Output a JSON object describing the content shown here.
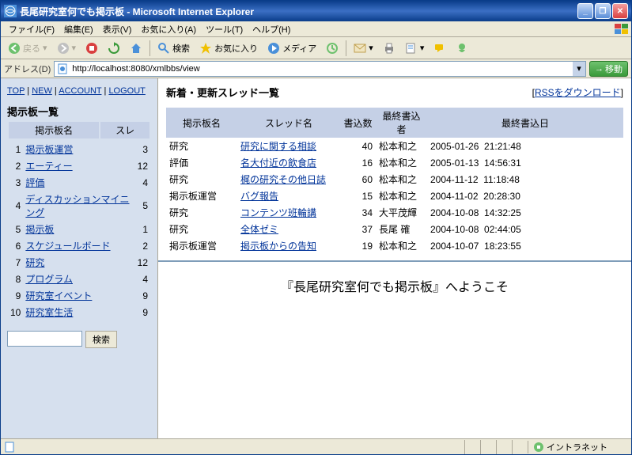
{
  "window": {
    "title": "長尾研究室何でも掲示板 - Microsoft Internet Explorer"
  },
  "menu": {
    "file": "ファイル(F)",
    "edit": "編集(E)",
    "view": "表示(V)",
    "favorites": "お気に入り(A)",
    "tools": "ツール(T)",
    "help": "ヘルプ(H)"
  },
  "toolbar": {
    "back": "戻る",
    "search": "検索",
    "favorites": "お気に入り",
    "media": "メディア"
  },
  "address": {
    "label": "アドレス(D)",
    "value": "http://localhost:8080/xmlbbs/view",
    "go": "移動"
  },
  "nav": {
    "top": "TOP",
    "new": "NEW",
    "account": "ACCOUNT",
    "logout": "LOGOUT"
  },
  "sidebar": {
    "heading": "掲示板一覧",
    "cols": {
      "name": "掲示板名",
      "count": "スレ"
    },
    "items": [
      {
        "n": "1",
        "name": "掲示板運営",
        "count": "3"
      },
      {
        "n": "2",
        "name": "エーティー",
        "count": "12"
      },
      {
        "n": "3",
        "name": "評価",
        "count": "4"
      },
      {
        "n": "4",
        "name": "ディスカッションマイニング",
        "count": "5"
      },
      {
        "n": "5",
        "name": "掲示板",
        "count": "1"
      },
      {
        "n": "6",
        "name": "スケジュールボード",
        "count": "2"
      },
      {
        "n": "7",
        "name": "研究",
        "count": "12"
      },
      {
        "n": "8",
        "name": "プログラム",
        "count": "4"
      },
      {
        "n": "9",
        "name": "研究室イベント",
        "count": "9"
      },
      {
        "n": "10",
        "name": "研究室生活",
        "count": "9"
      }
    ],
    "search_btn": "検索"
  },
  "main": {
    "heading": "新着・更新スレッド一覧",
    "rss": "RSSをダウンロード",
    "cols": {
      "board": "掲示板名",
      "thread": "スレッド名",
      "posts": "書込数",
      "lastposter": "最終書込者",
      "lastdate": "最終書込日"
    },
    "rows": [
      {
        "board": "研究",
        "thread": "研究に関する相談",
        "posts": "40",
        "poster": "松本和之",
        "date": "2005-01-26",
        "time": "21:21:48"
      },
      {
        "board": "評価",
        "thread": "名大付近の飲食店",
        "posts": "16",
        "poster": "松本和之",
        "date": "2005-01-13",
        "time": "14:56:31"
      },
      {
        "board": "研究",
        "thread": "梶の研究その他日誌",
        "posts": "60",
        "poster": "松本和之",
        "date": "2004-11-12",
        "time": "11:18:48"
      },
      {
        "board": "掲示板運営",
        "thread": "バグ報告",
        "posts": "15",
        "poster": "松本和之",
        "date": "2004-11-02",
        "time": "20:28:30"
      },
      {
        "board": "研究",
        "thread": "コンテンツ班輪講",
        "posts": "34",
        "poster": "大平茂輝",
        "date": "2004-10-08",
        "time": "14:32:25"
      },
      {
        "board": "研究",
        "thread": "全体ゼミ",
        "posts": "37",
        "poster": "長尾 確",
        "date": "2004-10-08",
        "time": "02:44:05"
      },
      {
        "board": "掲示板運営",
        "thread": "掲示板からの告知",
        "posts": "19",
        "poster": "松本和之",
        "date": "2004-10-07",
        "time": "18:23:55"
      }
    ],
    "welcome": "『長尾研究室何でも掲示板』へようこそ"
  },
  "status": {
    "zone": "イントラネット"
  }
}
